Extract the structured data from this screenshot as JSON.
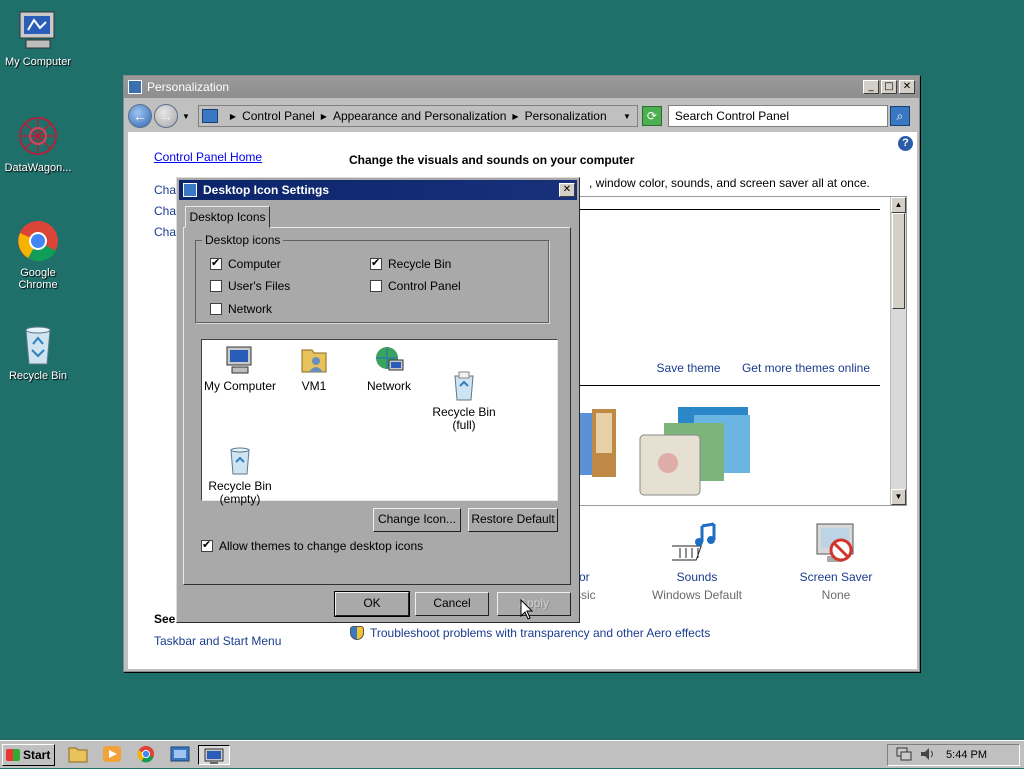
{
  "desktop": {
    "icons": [
      {
        "label": "My Computer"
      },
      {
        "label": "DataWagon..."
      },
      {
        "label": "Google Chrome"
      },
      {
        "label": "Recycle Bin"
      }
    ]
  },
  "window": {
    "title": "Personalization",
    "breadcrumb": [
      "Control Panel",
      "Appearance and Personalization",
      "Personalization"
    ],
    "search_placeholder": "Search Control Panel",
    "left_pane": {
      "home": "Control Panel Home",
      "items": [
        "Char",
        "Char",
        "Char"
      ]
    },
    "main_title": "Change the visuals and sounds on your computer",
    "main_subtitle": ", window color, sounds, and screen saver all at once.",
    "theme_links": {
      "save": "Save theme",
      "more": "Get more themes online"
    },
    "bottom_items": [
      {
        "name": "or",
        "value": "ssic"
      },
      {
        "name": "Sounds",
        "value": "Windows Default"
      },
      {
        "name": "Screen Saver",
        "value": "None"
      }
    ],
    "see_also": "See also",
    "taskbar_link": "Taskbar and Start Menu",
    "troubleshoot": "Troubleshoot problems with transparency and other Aero effects"
  },
  "dialog": {
    "title": "Desktop Icon Settings",
    "tab": "Desktop Icons",
    "group_label": "Desktop icons",
    "checkboxes": [
      {
        "label": "Computer",
        "checked": true
      },
      {
        "label": "Recycle Bin",
        "checked": true
      },
      {
        "label": "User's Files",
        "checked": false
      },
      {
        "label": "Control Panel",
        "checked": false
      },
      {
        "label": "Network",
        "checked": false
      }
    ],
    "icon_items": [
      {
        "label": "My Computer"
      },
      {
        "label": "VM1"
      },
      {
        "label": "Network"
      },
      {
        "label": "Recycle Bin\n(full)"
      },
      {
        "label": "Recycle Bin\n(empty)"
      }
    ],
    "buttons": {
      "change_icon": "Change Icon...",
      "restore_default": "Restore Default",
      "ok": "OK",
      "cancel": "Cancel",
      "apply": "Apply"
    },
    "allow_themes": {
      "label": "Allow themes to change desktop icons",
      "checked": true
    }
  },
  "taskbar": {
    "start_label": "Start",
    "clock": "5:44 PM"
  },
  "colors": {
    "desktop_bg": "#1f6f6b",
    "dialog_title_bg": "#0a246a",
    "link": "#1a3c8f"
  }
}
